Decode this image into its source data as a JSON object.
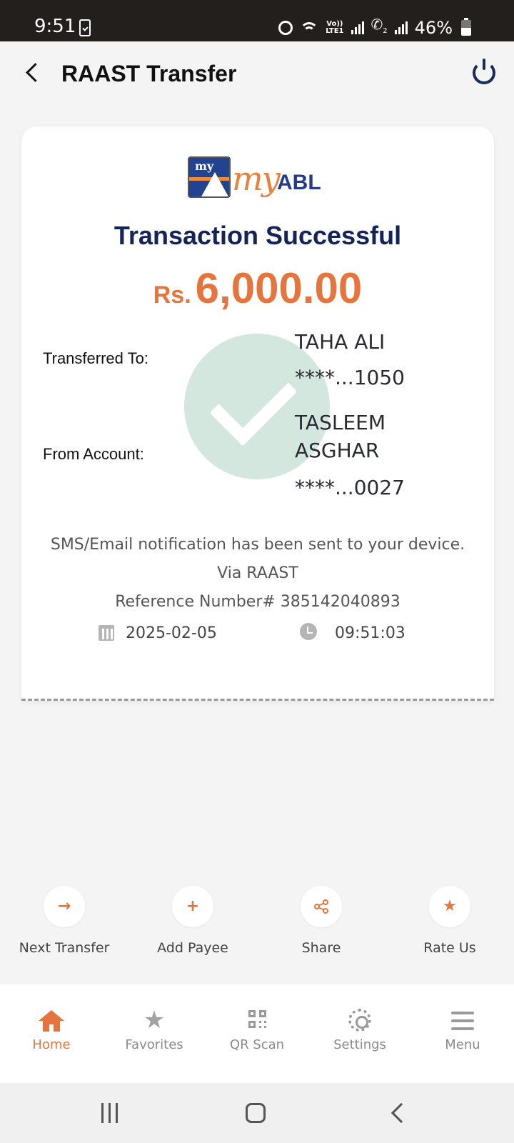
{
  "status_bar": {
    "time": "9:51",
    "volte": "Vo))",
    "lte": "LTE1",
    "sim2": "2",
    "battery": "46%"
  },
  "header": {
    "title": "RAAST Transfer"
  },
  "logo": {
    "text": "myABL"
  },
  "receipt": {
    "title": "Transaction Successful",
    "currency": "Rs.",
    "amount": "6,000.00",
    "transferred_to_label": "Transferred To:",
    "recipient_name": "TAHA ALI",
    "recipient_account": "****...1050",
    "from_account_label": "From Account:",
    "sender_name_line1": "TASLEEM",
    "sender_name_line2": "ASGHAR",
    "sender_account": "****...0027",
    "notification": "SMS/Email notification has been sent to your device.",
    "via": "Via RAAST",
    "reference": "Reference Number# 385142040893",
    "date": "2025-02-05",
    "time": "09:51:03"
  },
  "actions": [
    {
      "label": "Next Transfer",
      "icon": "arrow-right-icon",
      "glyph": "→"
    },
    {
      "label": "Add Payee",
      "icon": "plus-icon",
      "glyph": "+"
    },
    {
      "label": "Share",
      "icon": "share-icon",
      "glyph": "⋞"
    },
    {
      "label": "Rate Us",
      "icon": "star-icon",
      "glyph": "★"
    }
  ],
  "bottom_nav": [
    {
      "label": "Home",
      "icon": "home-icon",
      "active": true
    },
    {
      "label": "Favorites",
      "icon": "star-icon"
    },
    {
      "label": "QR Scan",
      "icon": "qr-code-icon"
    },
    {
      "label": "Settings",
      "icon": "gear-icon"
    },
    {
      "label": "Menu",
      "icon": "hamburger-menu-icon"
    }
  ],
  "colors": {
    "accent": "#e8743d",
    "brand_navy": "#14235a",
    "success_watermark": "#d4e7de",
    "status_bar": "#231f1c"
  }
}
